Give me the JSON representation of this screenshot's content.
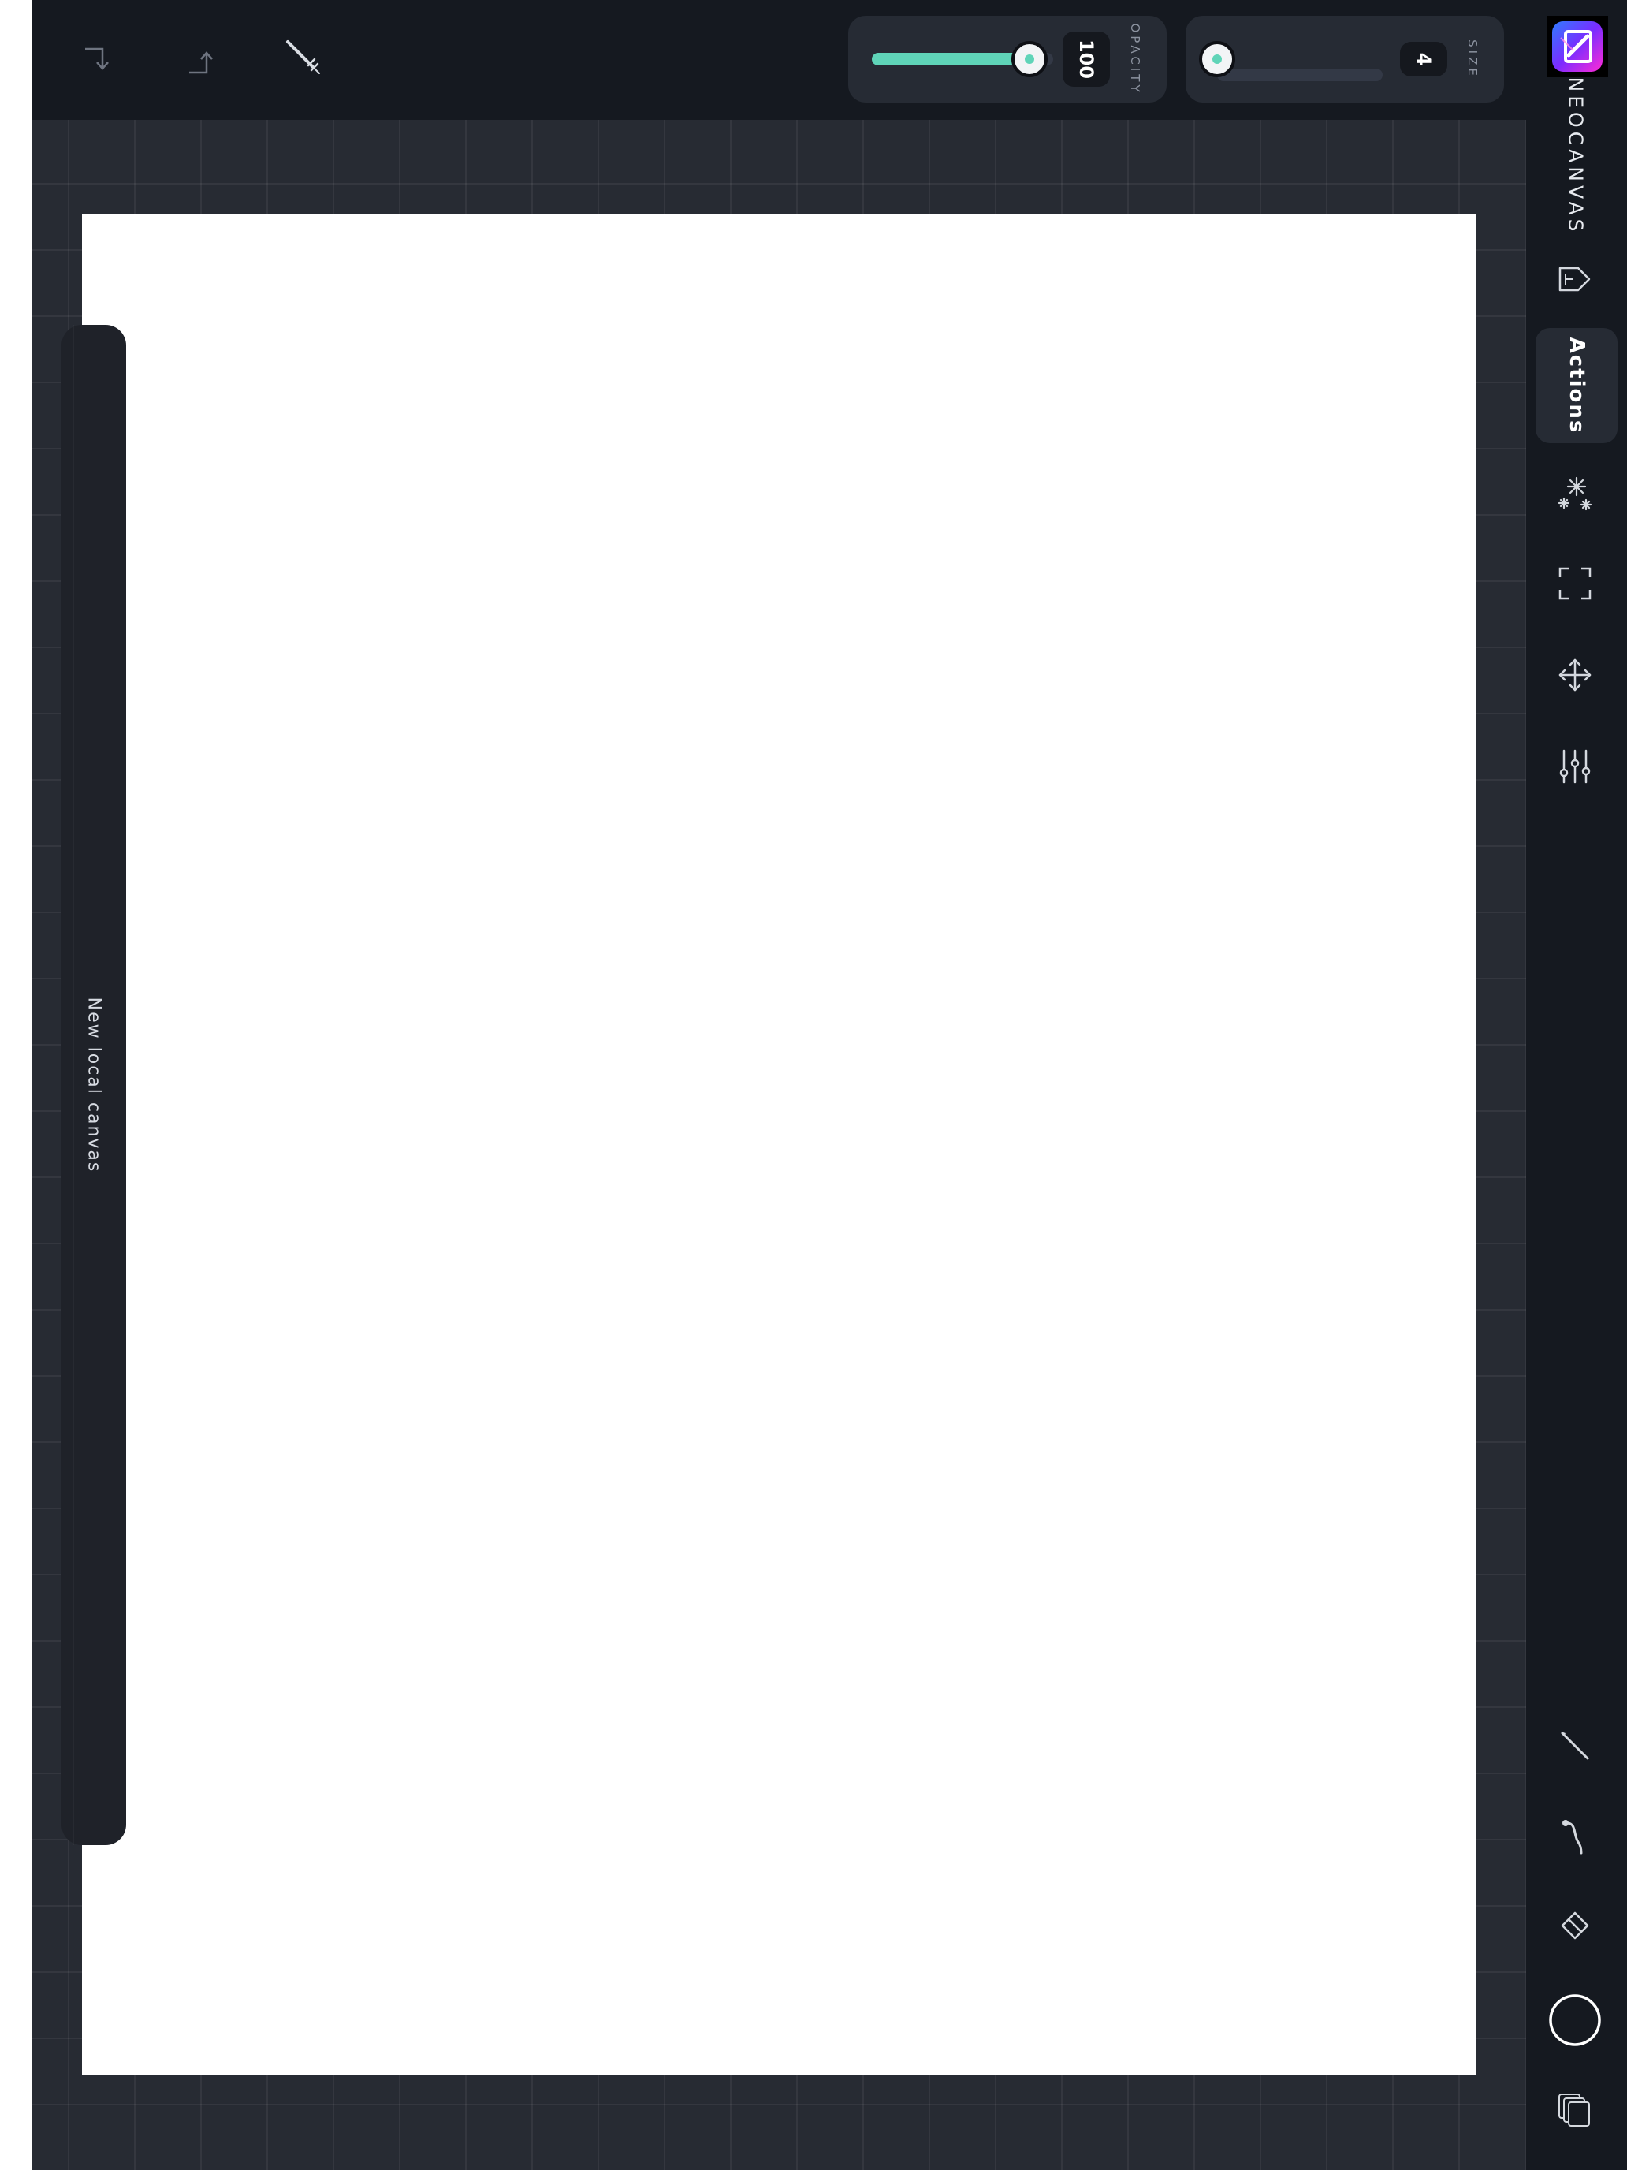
{
  "app": {
    "name": "NEOCANVAS",
    "logo_icon": "neocanvas-logo-icon"
  },
  "toolbar": {
    "undo_icon": "undo-arrow-icon",
    "redo_icon": "redo-arrow-icon",
    "eyedropper_icon": "eyedropper-icon",
    "opacity": {
      "label": "OPACITY",
      "value": "100",
      "fraction": 1.0
    },
    "size": {
      "label": "SIZE",
      "value": "4",
      "fraction": 0.0
    }
  },
  "canvas": {
    "title": "New local canvas",
    "paper_color": "#ffffff",
    "workspace_color": "#272b33"
  },
  "sidebar": {
    "actions_label": "Actions",
    "tools": [
      {
        "name": "export",
        "icon": "export-arrow-icon"
      },
      {
        "name": "effects",
        "icon": "sparkle-icon"
      },
      {
        "name": "selection",
        "icon": "selection-frame-icon"
      },
      {
        "name": "transform",
        "icon": "move-arrows-icon"
      },
      {
        "name": "adjustments",
        "icon": "sliders-icon"
      }
    ],
    "brush_tools": [
      {
        "name": "brush",
        "icon": "brush-icon"
      },
      {
        "name": "smudge",
        "icon": "smudge-icon"
      },
      {
        "name": "eraser",
        "icon": "eraser-icon"
      },
      {
        "name": "color",
        "icon": "color-swatch-icon",
        "color": "#151920"
      },
      {
        "name": "layers",
        "icon": "layers-icon"
      }
    ]
  },
  "colors": {
    "accent": "#5fd4b8",
    "chrome": "#151920",
    "panel": "#262b34"
  }
}
